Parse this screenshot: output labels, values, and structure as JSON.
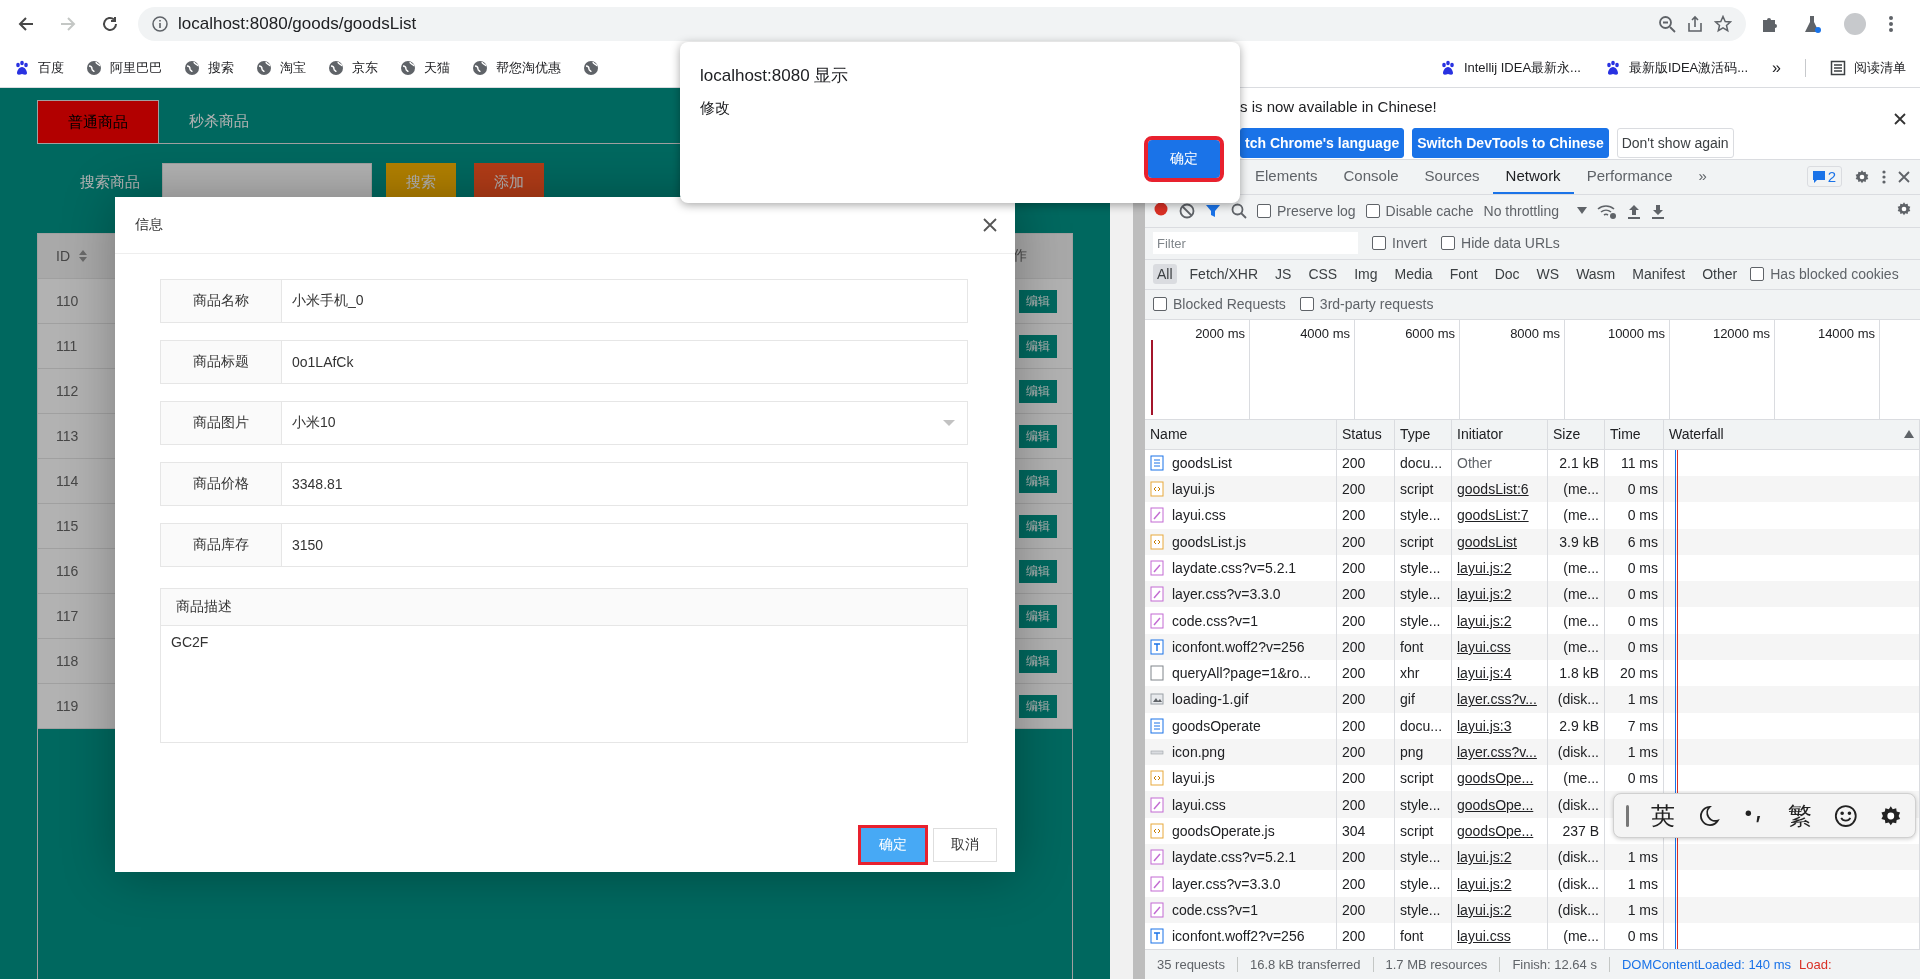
{
  "browser": {
    "nav": [
      {
        "kind": "back",
        "disabled": false
      },
      {
        "kind": "forward",
        "disabled": true
      },
      {
        "kind": "reload",
        "disabled": false
      }
    ],
    "url": "localhost:8080/goods/goodsList",
    "bookmarks": [
      {
        "kind": "paw",
        "label": "百度"
      },
      {
        "kind": "globe",
        "label": "阿里巴巴"
      },
      {
        "kind": "globe",
        "label": "搜索"
      },
      {
        "kind": "globe",
        "label": "淘宝"
      },
      {
        "kind": "globe",
        "label": "京东"
      },
      {
        "kind": "globe",
        "label": "天猫"
      },
      {
        "kind": "globe",
        "label": "帮您淘优惠"
      },
      {
        "kind": "globe"
      }
    ],
    "bookmarks_right": [
      {
        "kind": "paw",
        "label": "Intellij IDEA最新永..."
      },
      {
        "kind": "paw",
        "label": "最新版IDEA激活码..."
      }
    ],
    "overflow": "»",
    "reading_list": "阅读清单"
  },
  "page": {
    "tabs": [
      {
        "label": "普通商品",
        "selected": true
      },
      {
        "label": "秒杀商品",
        "selected": false
      }
    ],
    "search_label": "搜索商品",
    "search_button": "搜索",
    "add_button": "添加",
    "table": {
      "columns": [
        "ID",
        "作"
      ],
      "rows": [
        {
          "id": "110",
          "action": "编辑"
        },
        {
          "id": "111",
          "action": "编辑"
        },
        {
          "id": "112",
          "action": "编辑"
        },
        {
          "id": "113",
          "action": "编辑"
        },
        {
          "id": "114",
          "action": "编辑"
        },
        {
          "id": "115",
          "action": "编辑"
        },
        {
          "id": "116",
          "action": "编辑"
        },
        {
          "id": "117",
          "action": "编辑"
        },
        {
          "id": "118",
          "action": "编辑"
        },
        {
          "id": "119",
          "action": "编辑"
        }
      ]
    }
  },
  "modal": {
    "title": "信息",
    "fields": [
      {
        "kind": "input",
        "label": "商品名称",
        "value": "小米手机_0"
      },
      {
        "kind": "input",
        "label": "商品标题",
        "value": "0o1LAfCk"
      },
      {
        "kind": "select",
        "label": "商品图片",
        "value": "小米10"
      },
      {
        "kind": "input",
        "label": "商品价格",
        "value": "3348.81"
      },
      {
        "kind": "input",
        "label": "商品库存",
        "value": "3150"
      }
    ],
    "description": {
      "label": "商品描述",
      "value": "GC2F"
    },
    "buttons": [
      {
        "kind": "primary",
        "label": "确定",
        "highlighted": true
      },
      {
        "kind": "default",
        "label": "取消",
        "highlighted": false
      }
    ]
  },
  "alert": {
    "title": "localhost:8080 显示",
    "message": "修改",
    "button": "确定",
    "highlighted": true
  },
  "devtools": {
    "infobar": {
      "message": "s is now available in Chinese!",
      "buttons": [
        {
          "kind": "primary",
          "label": "tch Chrome's language"
        },
        {
          "kind": "primary",
          "label": "Switch DevTools to Chinese"
        },
        {
          "kind": "plain",
          "label": "Don't show again"
        }
      ]
    },
    "tabs": [
      {
        "label": "Elements",
        "selected": false
      },
      {
        "label": "Console",
        "selected": false
      },
      {
        "label": "Sources",
        "selected": false
      },
      {
        "label": "Network",
        "selected": true
      },
      {
        "label": "Performance",
        "selected": false
      }
    ],
    "more_tabs": "»",
    "issues_count": "2",
    "toolbar": {
      "recording": true,
      "checkboxes": [
        {
          "label": "Preserve log",
          "checked": false
        },
        {
          "label": "Disable cache",
          "checked": false
        }
      ],
      "throttling": "No throttling"
    },
    "filter": {
      "placeholder": "Filter",
      "checkboxes": [
        {
          "label": "Invert",
          "checked": false
        },
        {
          "label": "Hide data URLs",
          "checked": false
        }
      ],
      "types": [
        {
          "label": "All",
          "selected": true
        },
        {
          "label": "Fetch/XHR",
          "selected": false
        },
        {
          "label": "JS",
          "selected": false
        },
        {
          "label": "CSS",
          "selected": false
        },
        {
          "label": "Img",
          "selected": false
        },
        {
          "label": "Media",
          "selected": false
        },
        {
          "label": "Font",
          "selected": false
        },
        {
          "label": "Doc",
          "selected": false
        },
        {
          "label": "WS",
          "selected": false
        },
        {
          "label": "Wasm",
          "selected": false
        },
        {
          "label": "Manifest",
          "selected": false
        },
        {
          "label": "Other",
          "selected": false
        }
      ],
      "type_checkboxes": [
        {
          "label": "Has blocked cookies",
          "checked": false
        }
      ],
      "more_checkboxes": [
        {
          "label": "Blocked Requests",
          "checked": false
        },
        {
          "label": "3rd-party requests",
          "checked": false
        }
      ]
    },
    "overview": {
      "ticks": [
        "2000 ms",
        "4000 ms",
        "6000 ms",
        "8000 ms",
        "10000 ms",
        "12000 ms",
        "14000 ms"
      ]
    },
    "table": {
      "columns": [
        "Name",
        "Status",
        "Type",
        "Initiator",
        "Size",
        "Time",
        "Waterfall"
      ],
      "rows": [
        {
          "kind": "doc",
          "name": "goodsList",
          "status": "200",
          "type": "docu...",
          "initiator": "Other",
          "link": false,
          "size": "2.1 kB",
          "time": "11 ms"
        },
        {
          "kind": "script",
          "name": "layui.js",
          "status": "200",
          "type": "script",
          "initiator": "goodsList:6",
          "link": true,
          "size": "(me...",
          "time": "0 ms"
        },
        {
          "kind": "style",
          "name": "layui.css",
          "status": "200",
          "type": "style...",
          "initiator": "goodsList:7",
          "link": true,
          "size": "(me...",
          "time": "0 ms"
        },
        {
          "kind": "script",
          "name": "goodsList.js",
          "status": "200",
          "type": "script",
          "initiator": "goodsList",
          "link": true,
          "size": "3.9 kB",
          "time": "6 ms"
        },
        {
          "kind": "style",
          "name": "laydate.css?v=5.2.1",
          "status": "200",
          "type": "style...",
          "initiator": "layui.js:2",
          "link": true,
          "size": "(me...",
          "time": "0 ms"
        },
        {
          "kind": "style",
          "name": "layer.css?v=3.3.0",
          "status": "200",
          "type": "style...",
          "initiator": "layui.js:2",
          "link": true,
          "size": "(me...",
          "time": "0 ms"
        },
        {
          "kind": "style",
          "name": "code.css?v=1",
          "status": "200",
          "type": "style...",
          "initiator": "layui.js:2",
          "link": true,
          "size": "(me...",
          "time": "0 ms"
        },
        {
          "kind": "font",
          "name": "iconfont.woff2?v=256",
          "status": "200",
          "type": "font",
          "initiator": "layui.css",
          "link": true,
          "size": "(me...",
          "time": "0 ms"
        },
        {
          "kind": "xhr",
          "name": "queryAll?page=1&ro...",
          "status": "200",
          "type": "xhr",
          "initiator": "layui.js:4",
          "link": true,
          "size": "1.8 kB",
          "time": "20 ms"
        },
        {
          "kind": "gif",
          "name": "loading-1.gif",
          "status": "200",
          "type": "gif",
          "initiator": "layer.css?v...",
          "link": true,
          "size": "(disk...",
          "time": "1 ms"
        },
        {
          "kind": "doc",
          "name": "goodsOperate",
          "status": "200",
          "type": "docu...",
          "initiator": "layui.js:3",
          "link": true,
          "size": "2.9 kB",
          "time": "7 ms"
        },
        {
          "kind": "png",
          "name": "icon.png",
          "status": "200",
          "type": "png",
          "initiator": "layer.css?v...",
          "link": true,
          "size": "(disk...",
          "time": "1 ms"
        },
        {
          "kind": "script",
          "name": "layui.js",
          "status": "200",
          "type": "script",
          "initiator": "goodsOpe...",
          "link": true,
          "size": "(me...",
          "time": "0 ms"
        },
        {
          "kind": "style",
          "name": "layui.css",
          "status": "200",
          "type": "style...",
          "initiator": "goodsOpe...",
          "link": true,
          "size": "(disk..."
        },
        {
          "kind": "script",
          "name": "goodsOperate.js",
          "status": "304",
          "type": "script",
          "initiator": "goodsOpe...",
          "link": true,
          "size": "237 B"
        },
        {
          "kind": "style",
          "name": "laydate.css?v=5.2.1",
          "status": "200",
          "type": "style...",
          "initiator": "layui.js:2",
          "link": true,
          "size": "(disk...",
          "time": "1 ms"
        },
        {
          "kind": "style",
          "name": "layer.css?v=3.3.0",
          "status": "200",
          "type": "style...",
          "initiator": "layui.js:2",
          "link": true,
          "size": "(disk...",
          "time": "1 ms"
        },
        {
          "kind": "style",
          "name": "code.css?v=1",
          "status": "200",
          "type": "style...",
          "initiator": "layui.js:2",
          "link": true,
          "size": "(disk...",
          "time": "1 ms"
        },
        {
          "kind": "font",
          "name": "iconfont.woff2?v=256",
          "status": "200",
          "type": "font",
          "initiator": "layui.css",
          "link": true,
          "size": "(me...",
          "time": "0 ms"
        }
      ]
    },
    "status": [
      "35 requests",
      "16.8 kB transferred",
      "1.7 MB resources",
      "Finish: 12.64 s"
    ],
    "dom_content_loaded": "DOMContentLoaded: 140 ms",
    "load": "Load:"
  },
  "ime": {
    "items": [
      {
        "kind": "text",
        "label": "英"
      },
      {
        "kind": "moon"
      },
      {
        "kind": "punctuation"
      },
      {
        "kind": "text",
        "label": "繁"
      },
      {
        "kind": "smile"
      },
      {
        "kind": "gear"
      }
    ]
  }
}
